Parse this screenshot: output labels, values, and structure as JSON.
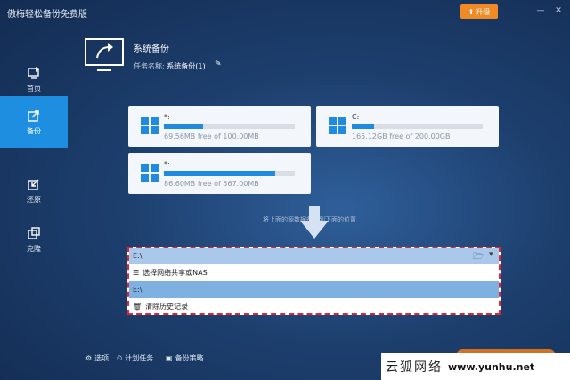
{
  "window": {
    "title": "傲梅轻松备份免费版",
    "upgrade_label": "升级",
    "minimize_glyph": "—",
    "close_glyph": "✕"
  },
  "sidebar": {
    "items": [
      {
        "label": "首页",
        "icon": "home-icon"
      },
      {
        "label": "备份",
        "icon": "backup-icon"
      },
      {
        "label": "还原",
        "icon": "restore-icon"
      },
      {
        "label": "克隆",
        "icon": "clone-icon"
      }
    ],
    "active_index": 1
  },
  "header": {
    "title": "系统备份",
    "task_label": "任务名称:",
    "task_name": "系统备份(1)"
  },
  "source_disks": [
    {
      "name": "*:",
      "info": "69.56MB free of 100.00MB",
      "used_fraction": 0.3
    },
    {
      "name": "C:",
      "info": "165.12GB free of 200.00GB",
      "used_fraction": 0.17
    },
    {
      "name": "*:",
      "info": "86.60MB free of 567.00MB",
      "used_fraction": 0.85
    }
  ],
  "hint": "将上面的源数据备份到下面的位置",
  "destination": {
    "value": "E:\\",
    "options": [
      {
        "label": "选择网络共享或NAS",
        "icon": "network-icon"
      },
      {
        "label": "E:\\",
        "icon": ""
      },
      {
        "label": "清除历史记录",
        "icon": "clear-icon"
      }
    ],
    "selected_index": 1
  },
  "footer": {
    "options_label": "选项",
    "schedule_label": "计划任务",
    "strategy_label": "备份策略"
  },
  "watermark": {
    "cn": "云狐网络",
    "url": "www.yunhu.net"
  },
  "colors": {
    "accent": "#1e8fe0",
    "upgrade": "#f08a24",
    "highlight": "#d9283a"
  }
}
